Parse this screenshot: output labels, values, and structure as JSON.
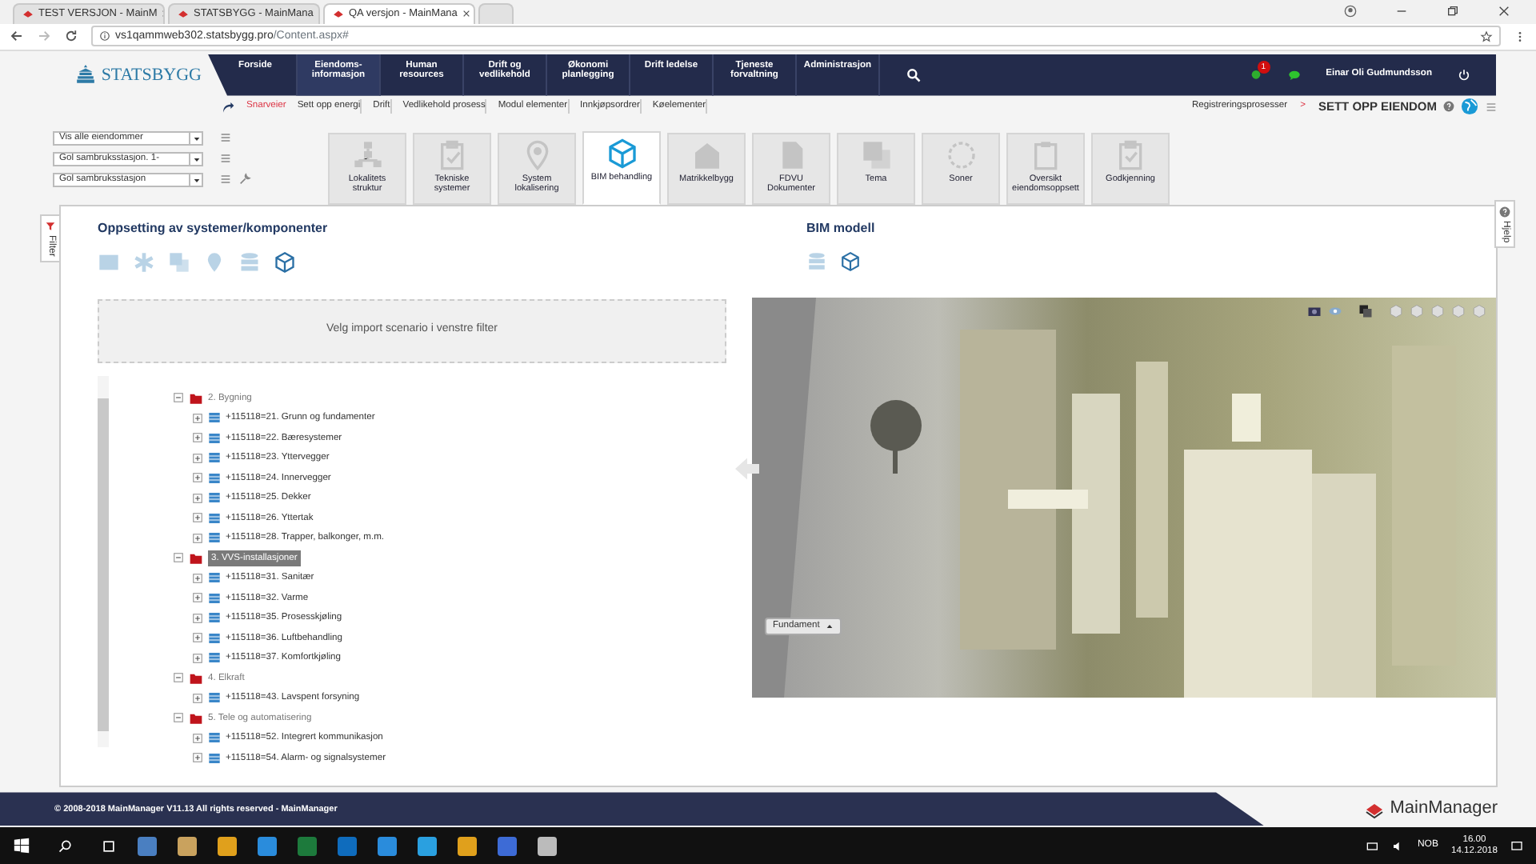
{
  "browser": {
    "tabs": [
      {
        "title": "TEST VERSJON - MainM",
        "selected": false
      },
      {
        "title": "STATSBYGG - MainMana",
        "selected": false
      },
      {
        "title": "QA versjon - MainMana",
        "selected": true
      }
    ],
    "url_host": "vs1qammweb302.statsbygg.pro",
    "url_path": "/Content.aspx#"
  },
  "header": {
    "logo": "STATSBYGG",
    "menu": [
      {
        "label": "Forside",
        "selected": false
      },
      {
        "label": "Eiendoms-\ninformasjon",
        "selected": true
      },
      {
        "label": "Human\nresources",
        "selected": false
      },
      {
        "label": "Drift og\nvedlikehold",
        "selected": false
      },
      {
        "label": "Økonomi\nplanlegging",
        "selected": false
      },
      {
        "label": "Drift ledelse",
        "selected": false
      },
      {
        "label": "Tjeneste\nforvaltning",
        "selected": false
      },
      {
        "label": "Administrasjon",
        "selected": false
      }
    ],
    "notification_count": "1",
    "user": "Einar Oli Gudmundsson"
  },
  "shortcuts": {
    "label": "Snarveier",
    "items": [
      "Sett opp energi",
      "Drift",
      "Vedlikehold prosess",
      "Modul elementer",
      "Innkjøpsordrer",
      "Køelementer"
    ]
  },
  "breadcrumb": {
    "parent": "Registreringsprosesser",
    "separator": ">",
    "current": "SETT OPP EIENDOM"
  },
  "filters": [
    {
      "value": "Vis alle eiendommer",
      "has_tool": false
    },
    {
      "value": "Gol sambruksstasjon. 1-",
      "has_tool": false
    },
    {
      "value": "Gol sambruksstasjon",
      "has_tool": true
    }
  ],
  "modules": [
    {
      "label": "Lokalitets\nstruktur",
      "selected": false
    },
    {
      "label": "Tekniske\nsystemer",
      "selected": false
    },
    {
      "label": "System\nlokalisering",
      "selected": false
    },
    {
      "label": "BIM behandling",
      "selected": true
    },
    {
      "label": "Matrikkelbygg",
      "selected": false
    },
    {
      "label": "FDVU\nDokumenter",
      "selected": false
    },
    {
      "label": "Tema",
      "selected": false
    },
    {
      "label": "Soner",
      "selected": false
    },
    {
      "label": "Oversikt\neiendomsoppsett",
      "selected": false
    },
    {
      "label": "Godkjenning",
      "selected": false
    }
  ],
  "side_tabs": {
    "left": "Filter",
    "right": "Hjelp"
  },
  "left_panel": {
    "title": "Oppsetting av systemer/komponenter",
    "tools": [
      {
        "selected": false
      },
      {
        "selected": false
      },
      {
        "selected": false
      },
      {
        "selected": false
      },
      {
        "selected": false
      },
      {
        "selected": true
      }
    ],
    "import_hint": "Velg import scenario i venstre filter",
    "tree": [
      {
        "label": "2. Bygning",
        "kind": "folder",
        "expanded": true,
        "selected": false,
        "children": [
          {
            "label": "+115118=21. Grunn og fundamenter",
            "kind": "item",
            "expanded": false,
            "selected": false
          },
          {
            "label": "+115118=22. Bæresystemer",
            "kind": "item",
            "expanded": false,
            "selected": false
          },
          {
            "label": "+115118=23. Yttervegger",
            "kind": "item",
            "expanded": false,
            "selected": false
          },
          {
            "label": "+115118=24. Innervegger",
            "kind": "item",
            "expanded": false,
            "selected": false
          },
          {
            "label": "+115118=25. Dekker",
            "kind": "item",
            "expanded": false,
            "selected": false
          },
          {
            "label": "+115118=26. Yttertak",
            "kind": "item",
            "expanded": false,
            "selected": false
          },
          {
            "label": "+115118=28. Trapper, balkonger, m.m.",
            "kind": "item",
            "expanded": false,
            "selected": false
          }
        ]
      },
      {
        "label": "3. VVS-installasjoner",
        "kind": "folder",
        "expanded": true,
        "selected": true,
        "children": [
          {
            "label": "+115118=31. Sanitær",
            "kind": "item",
            "expanded": false,
            "selected": false
          },
          {
            "label": "+115118=32. Varme",
            "kind": "item",
            "expanded": false,
            "selected": false
          },
          {
            "label": "+115118=35. Prosesskjøling",
            "kind": "item",
            "expanded": false,
            "selected": false
          },
          {
            "label": "+115118=36. Luftbehandling",
            "kind": "item",
            "expanded": false,
            "selected": false
          },
          {
            "label": "+115118=37. Komfortkjøling",
            "kind": "item",
            "expanded": false,
            "selected": false
          }
        ]
      },
      {
        "label": "4. Elkraft",
        "kind": "folder",
        "expanded": true,
        "selected": false,
        "children": [
          {
            "label": "+115118=43. Lavspent forsyning",
            "kind": "item",
            "expanded": false,
            "selected": false
          }
        ]
      },
      {
        "label": "5. Tele og automatisering",
        "kind": "folder",
        "expanded": true,
        "selected": false,
        "children": [
          {
            "label": "+115118=52. Integrert kommunikasjon",
            "kind": "item",
            "expanded": false,
            "selected": false
          },
          {
            "label": "+115118=54. Alarm- og signalsystemer",
            "kind": "item",
            "expanded": false,
            "selected": false
          }
        ]
      }
    ]
  },
  "right_panel": {
    "title": "BIM modell",
    "tools": [
      {
        "selected": false
      },
      {
        "selected": true
      }
    ],
    "layer_button": "Fundament"
  },
  "footer": {
    "copyright": "© 2008-2018 MainManager V11.13 All rights reserved - MainManager",
    "brand": "MainManager"
  },
  "taskbar": {
    "language": "NOB",
    "time": "16.00",
    "date": "14.12.2018"
  }
}
